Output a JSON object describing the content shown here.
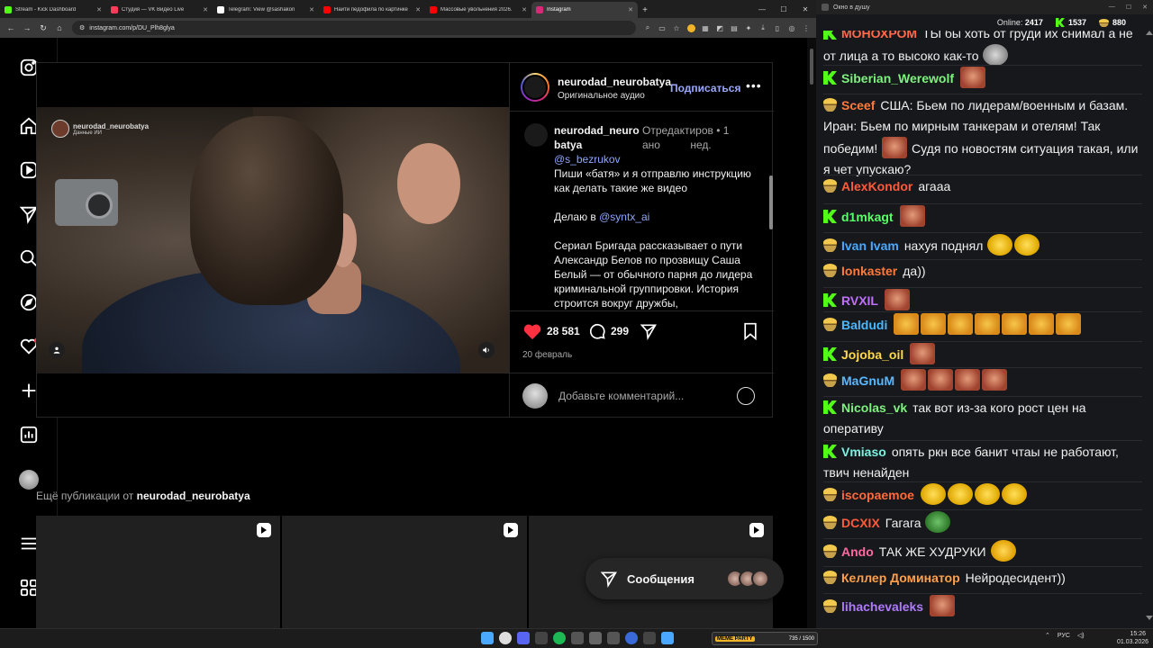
{
  "browser": {
    "tabs": [
      {
        "title": "Stream - Kick Dashboard",
        "color": "#53fc18",
        "active": false
      },
      {
        "title": "Студия — VK Видео Live",
        "color": "#ff3b5c",
        "active": false
      },
      {
        "title": "Telegram: View @sashakon",
        "color": "#ffffff",
        "active": false
      },
      {
        "title": "Найти педофила по картинке",
        "color": "#ff0000",
        "active": false
      },
      {
        "title": "Массовые увольнения 2026.",
        "color": "#ff0000",
        "active": false
      },
      {
        "title": "Instagram",
        "color": "#d62976",
        "active": true
      }
    ],
    "url": "instagram.com/p/DU_Plh8glya"
  },
  "post": {
    "username": "neurodad_neurobatya",
    "audio": "Оригинальное аудио",
    "follow_label": "Подписаться",
    "video_watermark_name": "neurodad_neurobatya",
    "video_watermark_sub": "Данные ИИ",
    "caption_user_line1": "neurodad_neuro",
    "caption_user_line2": "batya",
    "caption_meta_line1": "Отредактиров • 1",
    "caption_meta_line2": "ано          нед.",
    "mention": "@s_bezrukov",
    "caption_p1": "Пиши «батя» и я отправлю инструкцию как делать такие же видео",
    "caption_p2_prefix": "Делаю в ",
    "caption_p2_link": "@syntx_ai",
    "caption_p3": "Сериал Бригада рассказывает о пути Александр Белов по прозвищу Саша Белый — от обычного парня до лидера криминальной группировки. История строится вокруг дружбы,",
    "likes": "28 581",
    "comments": "299",
    "date": "20 февраль",
    "comment_placeholder": "Добавьте комментарий..."
  },
  "more": {
    "prefix": "Ещё публикации от ",
    "user": "neurodad_neurobatya"
  },
  "messages_label": "Сообщения",
  "chat": {
    "title": "Окно в душу",
    "online_label": "Online:",
    "online": "2417",
    "kick_count": "1537",
    "vk_count": "880",
    "messages": [
      {
        "platform": "kick",
        "user": "МОНОХРОМ",
        "color": "#ff6a4a",
        "text": "ТЫ бы хоть от груди их снимал а не от лица а то высоко как-то",
        "emotes": [
          "bald"
        ]
      },
      {
        "platform": "kick",
        "user": "Siberian_Werewolf",
        "color": "#7ef27e",
        "text": "",
        "emotes": [
          "face"
        ]
      },
      {
        "platform": "vk",
        "user": "Sceef",
        "color": "#ff7a3c",
        "text": "США: Бьем по лидерам/военным и базам. Иран: Бьем по мирным танкерам и отелям! Так победим!",
        "text2": "Судя по новостям ситуация такая, или я чет упускаю?",
        "emotes": [
          "face"
        ]
      },
      {
        "platform": "vk",
        "user": "AlexKondor",
        "color": "#ff5a3c",
        "text": "агааа",
        "emotes": []
      },
      {
        "platform": "kick",
        "user": "d1mkagt",
        "color": "#59ff6a",
        "text": "",
        "emotes": [
          "face"
        ]
      },
      {
        "platform": "vk",
        "user": "Ivan Ivam",
        "color": "#4aa8ff",
        "text": "нахуя поднял",
        "emotes": [
          "lol",
          "lol"
        ]
      },
      {
        "platform": "vk",
        "user": "Ionkaster",
        "color": "#ff7a3c",
        "text": "да))",
        "emotes": []
      },
      {
        "platform": "kick",
        "user": "RVXIL",
        "color": "#c070ff",
        "text": "",
        "emotes": [
          "face"
        ]
      },
      {
        "platform": "vk",
        "user": "Baldudi",
        "color": "#4ab8ff",
        "text": "",
        "emotes": [
          "tiger",
          "tiger",
          "tiger",
          "tiger",
          "tiger",
          "tiger",
          "tiger"
        ]
      },
      {
        "platform": "kick",
        "user": "Jojoba_oil",
        "color": "#ffd84a",
        "text": "",
        "emotes": [
          "face"
        ]
      },
      {
        "platform": "vk",
        "user": "MaGnuM",
        "color": "#5ab8ff",
        "text": "",
        "emotes": [
          "face",
          "face",
          "face",
          "face"
        ]
      },
      {
        "platform": "kick",
        "user": "Nicolas_vk",
        "color": "#7ef27e",
        "text": "так вот из-за кого рост цен на оперативу",
        "emotes": []
      },
      {
        "platform": "kick",
        "user": "Vmiaso",
        "color": "#7ef2e0",
        "text": "опять ркн все банит чтаы не работают, твич ненайден",
        "emotes": []
      },
      {
        "platform": "vk",
        "user": "iscopaemoe",
        "color": "#ff6a3c",
        "text": "",
        "emotes": [
          "lol",
          "lol",
          "lol",
          "lol"
        ]
      },
      {
        "platform": "vk",
        "user": "DCXIX",
        "color": "#ff5a3c",
        "text": "Гагага",
        "emotes": [
          "frog"
        ]
      },
      {
        "platform": "vk",
        "user": "Ando",
        "color": "#ff6aa0",
        "text": "ТАК ЖЕ ХУДРУКИ",
        "emotes": [
          "cool"
        ]
      },
      {
        "platform": "vk",
        "user": "Келлер Доминатор",
        "color": "#ffa04a",
        "text": "Нейродесидент))",
        "emotes": []
      },
      {
        "platform": "vk",
        "user": "lihachevaleks",
        "color": "#b07aff",
        "text": "",
        "emotes": [
          "face"
        ]
      }
    ]
  },
  "taskbar": {
    "badge_tag": "MEME PARTY",
    "badge_text": "735 / 1500",
    "lang": "РУС",
    "time": "15:26",
    "date": "01.03.2026"
  }
}
